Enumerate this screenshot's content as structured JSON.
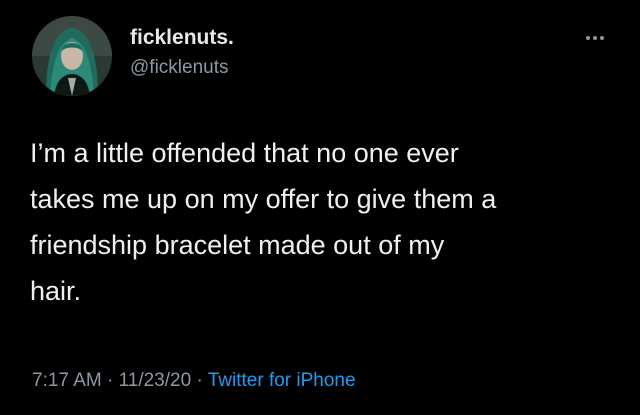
{
  "author": {
    "display_name": "ficklenuts.",
    "handle": "@ficklenuts",
    "avatar_icon": "profile-photo"
  },
  "more_icon": "more-dots-icon",
  "tweet": {
    "lines": [
      "I’m a little offended that no one ever",
      "takes me up on my offer to give them a",
      "friendship bracelet made out of my",
      "hair."
    ]
  },
  "meta": {
    "time": "7:17 AM",
    "separator": " · ",
    "date": "11/23/20",
    "source": "Twitter for iPhone"
  },
  "colors": {
    "background": "#000000",
    "text": "#e7e9ea",
    "muted": "#8b98a5",
    "link": "#1d9bf0"
  }
}
